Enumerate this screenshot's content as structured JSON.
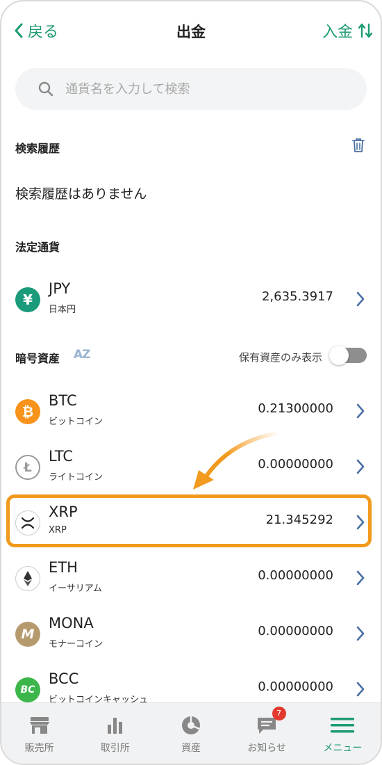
{
  "header": {
    "back_label": "戻る",
    "title": "出金",
    "deposit_label": "入金"
  },
  "search": {
    "placeholder": "通貨名を入力して検索"
  },
  "history": {
    "heading": "検索履歴",
    "empty_text": "検索履歴はありません"
  },
  "fiat": {
    "heading": "法定通貨",
    "items": [
      {
        "symbol": "JPY",
        "name": "日本円",
        "amount": "2,635.3917",
        "icon": "yen-icon",
        "color": "#1a9b7a"
      }
    ]
  },
  "crypto": {
    "heading": "暗号資産",
    "sort_icon": "AZ",
    "holdings_only_label": "保有資産のみ表示",
    "holdings_only_on": false,
    "items": [
      {
        "symbol": "BTC",
        "name": "ビットコイン",
        "amount": "0.21300000",
        "icon": "bitcoin-icon",
        "color": "#f7931a"
      },
      {
        "symbol": "LTC",
        "name": "ライトコイン",
        "amount": "0.00000000",
        "icon": "litecoin-icon",
        "color": "#bdbdbd"
      },
      {
        "symbol": "XRP",
        "name": "XRP",
        "amount": "21.345292",
        "icon": "xrp-icon",
        "color": "#222222"
      },
      {
        "symbol": "ETH",
        "name": "イーサリアム",
        "amount": "0.00000000",
        "icon": "ethereum-icon",
        "color": "#333333"
      },
      {
        "symbol": "MONA",
        "name": "モナーコイン",
        "amount": "0.00000000",
        "icon": "monacoin-icon",
        "color": "#b59a6e"
      },
      {
        "symbol": "BCC",
        "name": "ビットコインキャッシュ",
        "amount": "0.00000000",
        "icon": "bitcoin-cash-icon",
        "color": "#3cb64a"
      }
    ]
  },
  "tabbar": {
    "items": [
      {
        "label": "販売所",
        "icon": "store-icon"
      },
      {
        "label": "取引所",
        "icon": "bar-chart-icon"
      },
      {
        "label": "資産",
        "icon": "pie-chart-icon"
      },
      {
        "label": "お知らせ",
        "icon": "message-icon",
        "badge": "7"
      },
      {
        "label": "メニュー",
        "icon": "menu-icon",
        "active": true
      }
    ]
  },
  "colors": {
    "accent": "#1e9b74",
    "highlight": "#f29a1e",
    "badge": "#e23a2e"
  }
}
